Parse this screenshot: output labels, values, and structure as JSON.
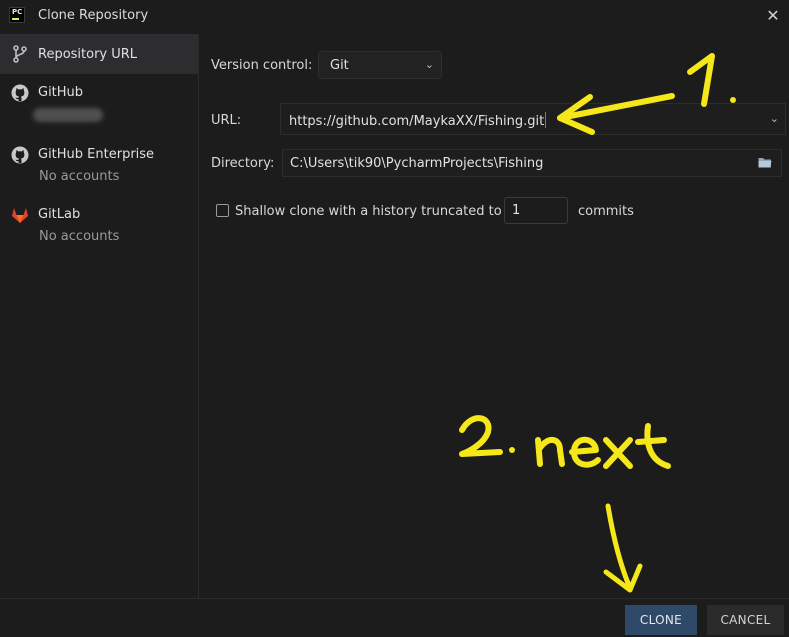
{
  "window": {
    "title": "Clone Repository",
    "close_label": "✕"
  },
  "sidebar": {
    "items": [
      {
        "label": "Repository URL",
        "sub": ""
      },
      {
        "label": "GitHub",
        "sub": ""
      },
      {
        "label": "GitHub Enterprise",
        "sub": "No accounts"
      },
      {
        "label": "GitLab",
        "sub": "No accounts"
      }
    ]
  },
  "form": {
    "version_control_label": "Version control:",
    "version_control_value": "Git",
    "url_label": "URL:",
    "url_value": "https://github.com/MaykaXX/Fishing.git",
    "directory_label": "Directory:",
    "directory_value": "C:\\Users\\tik90\\PycharmProjects\\Fishing",
    "shallow_label": "Shallow clone with a history truncated to",
    "shallow_checked": false,
    "shallow_depth": "1",
    "commits_label": "commits"
  },
  "buttons": {
    "clone": "CLONE",
    "cancel": "CANCEL"
  },
  "annotations": {
    "step1": "1.",
    "step2": "2. next",
    "color": "#f5e71a"
  },
  "colors": {
    "selected_bg": "#2d2d30",
    "primary_btn": "#2f4a68",
    "caret": "#e05050"
  }
}
